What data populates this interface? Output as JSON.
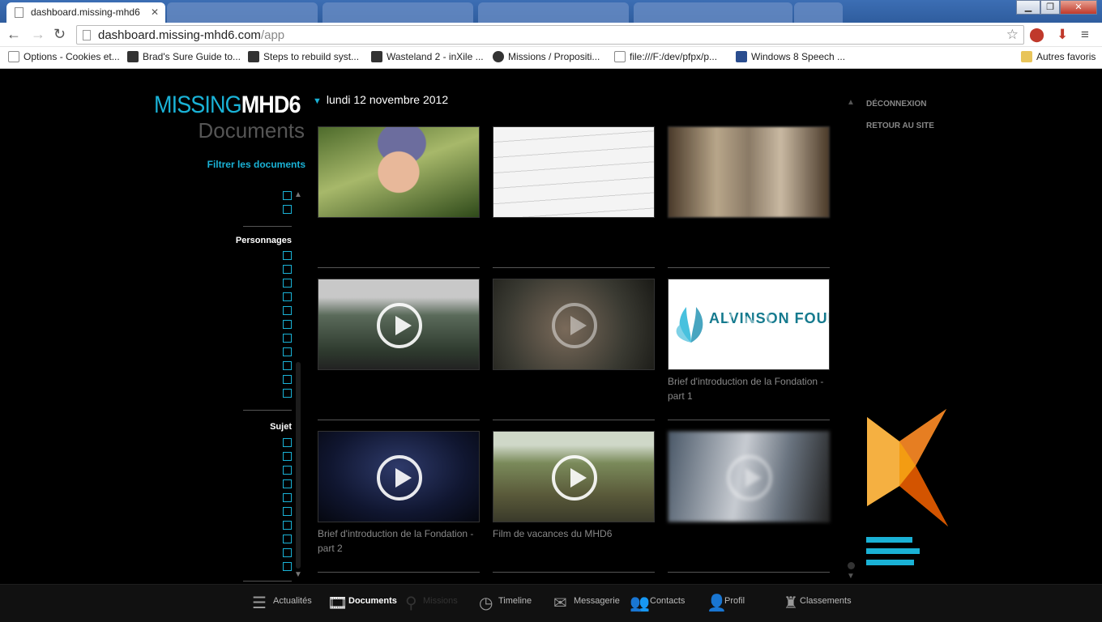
{
  "browser": {
    "active_tab": {
      "title": "dashboard.missing-mhd6"
    },
    "url": {
      "domain": "dashboard.missing-mhd6.com",
      "path": "/app"
    },
    "bookmarks": [
      {
        "label": "Options - Cookies et..."
      },
      {
        "label": "Brad's Sure Guide to..."
      },
      {
        "label": "Steps to rebuild syst..."
      },
      {
        "label": "Wasteland 2 - inXile ..."
      },
      {
        "label": "Missions / Propositi..."
      },
      {
        "label": "file:///F:/dev/pfpx/p..."
      },
      {
        "label": "Windows 8 Speech ..."
      }
    ],
    "other_bookmarks": "Autres favoris"
  },
  "brand": {
    "part1": "MISSING",
    "part2": "MHD6"
  },
  "section_title": "Documents",
  "date": "lundi 12 novembre 2012",
  "filters": {
    "title": "Filtrer les documents",
    "groups": [
      {
        "title": "Personnages"
      },
      {
        "title": "Sujet"
      }
    ]
  },
  "documents": [
    {
      "caption": "",
      "type": "photo"
    },
    {
      "caption": "",
      "type": "photo"
    },
    {
      "caption": "",
      "type": "photo"
    },
    {
      "caption": "",
      "type": "video"
    },
    {
      "caption": "",
      "type": "video"
    },
    {
      "caption": "Brief d'introduction de la Fondation - part 1",
      "type": "video",
      "logo": "ALVINSON FOUNDATION"
    },
    {
      "caption": "Brief d'introduction de la Fondation - part 2",
      "type": "video"
    },
    {
      "caption": "Film de vacances du MHD6",
      "type": "video"
    },
    {
      "caption": "",
      "type": "video"
    }
  ],
  "right_links": {
    "logout": "DÉCONNEXION",
    "back": "RETOUR AU SITE"
  },
  "bottom_nav": [
    {
      "label": "Actualités"
    },
    {
      "label": "Documents"
    },
    {
      "label": "Missions"
    },
    {
      "label": "Timeline"
    },
    {
      "label": "Messagerie"
    },
    {
      "label": "Contacts"
    },
    {
      "label": "Profil"
    },
    {
      "label": "Classements"
    }
  ],
  "colors": {
    "accent": "#1ab2d6",
    "background": "#000000",
    "orange": "#f39c12"
  }
}
